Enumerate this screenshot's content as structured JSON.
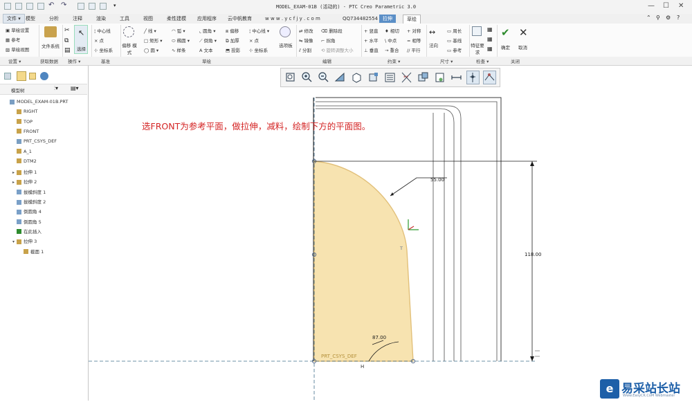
{
  "window": {
    "title": "MODEL_EXAM-01B (活动的) - PTC Creo Parametric 3.0"
  },
  "tabs": {
    "file": "文件 ▾",
    "items": [
      "模型",
      "分析",
      "注释",
      "渲染",
      "工具",
      "视图",
      "柔性建模",
      "应用程序",
      "云中帆教育",
      "w w w . y c f j y . c o m",
      "QQ734482554",
      "拉伸",
      "草绘"
    ],
    "active": "草绘",
    "contextual": "拉伸"
  },
  "ribbon": {
    "setup": [
      "草绘设置",
      "参考",
      "草绘视图"
    ],
    "get_data": "文件系统",
    "operations": [
      "选择"
    ],
    "base": [
      "中心线",
      "点",
      "坐标系"
    ],
    "palette": "偏移 模式",
    "sketch_row1": [
      "线",
      "弧",
      "圆角",
      "倒角"
    ],
    "sketch_row2": [
      "矩形",
      "椭圆",
      "样条",
      "文本"
    ],
    "sketch_row3": [
      "圆",
      "投影",
      "加厚",
      "偏移"
    ],
    "datum": [
      "中心线",
      "点",
      "坐标系"
    ],
    "palette2": "选项板",
    "edit": [
      "修改",
      "删除段",
      "镜像",
      "拐角",
      "分割",
      "旋转调整大小"
    ],
    "constraints": [
      "竖直",
      "相切",
      "对称",
      "水平",
      "中点",
      "相等",
      "垂直",
      "重合",
      "平行"
    ],
    "dimension": [
      "法向",
      "周长",
      "基线",
      "参考"
    ],
    "inspect": "特征要求",
    "close": {
      "ok": "确定",
      "cancel": "取消"
    }
  },
  "group_labels": [
    "设置 ▾",
    "获取数据",
    "操作 ▾",
    "基准",
    "草绘",
    "编辑",
    "约束 ▾",
    "尺寸 ▾",
    "检查 ▾",
    "关闭"
  ],
  "model_tree": {
    "header": "模型树",
    "items": [
      {
        "label": "MODEL_EXAM-01B.PRT",
        "indent": 0,
        "expand": "",
        "icon": "part"
      },
      {
        "label": "RIGHT",
        "indent": 1,
        "expand": "",
        "icon": "plane"
      },
      {
        "label": "TOP",
        "indent": 1,
        "expand": "",
        "icon": "plane"
      },
      {
        "label": "FRONT",
        "indent": 1,
        "expand": "",
        "icon": "plane"
      },
      {
        "label": "PRT_CSYS_DEF",
        "indent": 1,
        "expand": "",
        "icon": "csys"
      },
      {
        "label": "A_1",
        "indent": 1,
        "expand": "",
        "icon": "axis"
      },
      {
        "label": "DTM2",
        "indent": 1,
        "expand": "",
        "icon": "plane"
      },
      {
        "label": "拉伸 1",
        "indent": 1,
        "expand": "▸",
        "icon": "extrude"
      },
      {
        "label": "拉伸 2",
        "indent": 1,
        "expand": "▸",
        "icon": "extrude"
      },
      {
        "label": "拔模斜度 1",
        "indent": 1,
        "expand": "",
        "icon": "draft"
      },
      {
        "label": "拔模斜度 2",
        "indent": 1,
        "expand": "",
        "icon": "draft"
      },
      {
        "label": "倒圆角 4",
        "indent": 1,
        "expand": "",
        "icon": "round"
      },
      {
        "label": "倒圆角 5",
        "indent": 1,
        "expand": "",
        "icon": "round"
      },
      {
        "label": "在此插入",
        "indent": 1,
        "expand": "",
        "icon": "insert"
      },
      {
        "label": "拉伸 3",
        "indent": 1,
        "expand": "▾",
        "icon": "extrude"
      },
      {
        "label": "截面 1",
        "indent": 2,
        "expand": "",
        "icon": "section"
      }
    ]
  },
  "canvas": {
    "instruction": "选FRONT为参考平面，做拉伸，减料，绘制下方的平面图。",
    "dim_radius": "55.00",
    "dim_height": "118.00",
    "dim_angle": "87.00",
    "csys_label": "PRT_CSYS_DEF",
    "tangent_mark": "T",
    "h_mark": "H"
  },
  "colors": {
    "instruction": "#d42525",
    "sketch_fill": "#f7e3b0",
    "sketch_edge": "#e2c07a",
    "ref_line": "#3f6c8a",
    "dim_line": "#1a1a1a",
    "ctx_tab": "#5b8fc7"
  },
  "watermark": {
    "name": "易采站长站",
    "sub": "Www.EasyCK.CoM Webmaster"
  }
}
